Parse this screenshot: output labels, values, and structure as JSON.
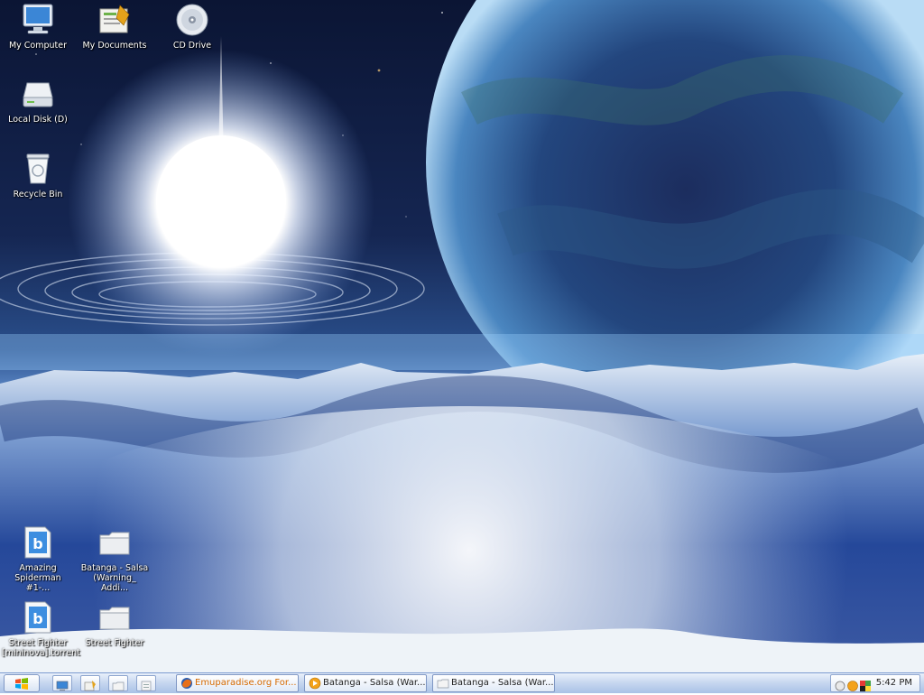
{
  "desktop": {
    "icons": [
      {
        "label": "My Computer",
        "icon": "my-computer-icon"
      },
      {
        "label": "My Documents",
        "icon": "my-documents-icon"
      },
      {
        "label": "CD Drive",
        "icon": "cd-drive-icon"
      },
      {
        "label": "Local Disk (D)",
        "icon": "local-disk-icon"
      },
      {
        "label": "Recycle Bin",
        "icon": "recycle-bin-icon"
      },
      {
        "label": "Amazing Spiderman #1-...",
        "icon": "torrent-file-icon"
      },
      {
        "label": "Batanga - Salsa (Warning_ Addi...",
        "icon": "folder-icon"
      },
      {
        "label": "Street Fighter [mininova].torrent",
        "icon": "torrent-file-icon"
      },
      {
        "label": "Street Fighter",
        "icon": "folder-icon"
      }
    ]
  },
  "taskbar": {
    "tasks": [
      {
        "label": "Emuparadise.org For...",
        "icon": "firefox-icon",
        "active": true
      },
      {
        "label": "Batanga - Salsa (War...",
        "icon": "media-player-icon",
        "active": false
      },
      {
        "label": "Batanga - Salsa (War...",
        "icon": "folder-icon",
        "active": false
      }
    ],
    "clock": "5:42 PM"
  },
  "colors": {
    "taskbar": "#c8d8f0",
    "active_task_text": "#d66a00",
    "icon_label": "#ffffff"
  }
}
